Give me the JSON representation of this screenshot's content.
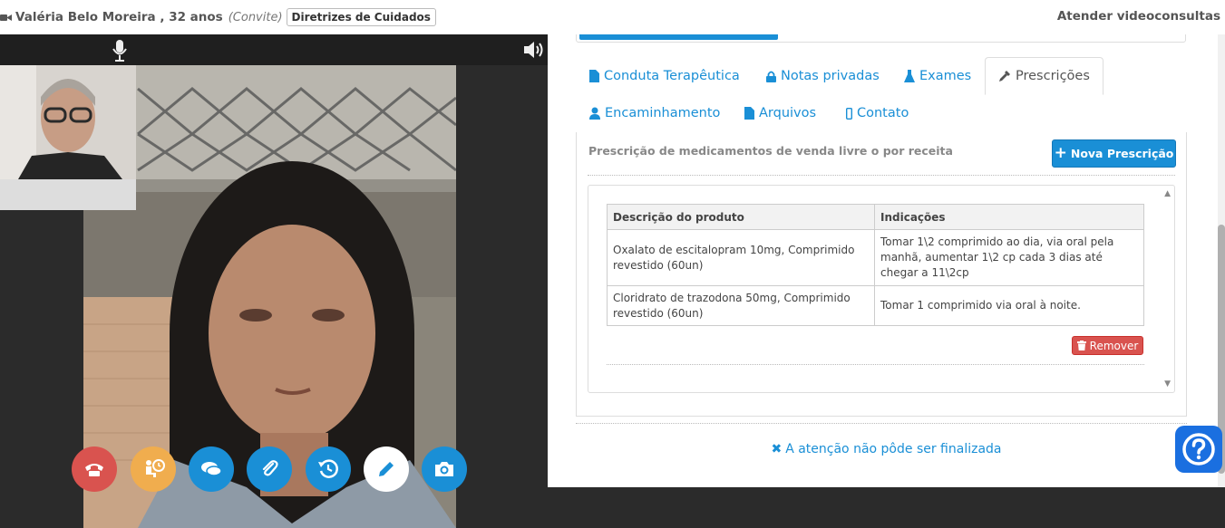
{
  "header": {
    "patient_name": "Valéria Belo Moreira , 32 anos",
    "convite": "(Convite)",
    "diretrizes_button": "Diretrizes de Cuidados",
    "attend_link": "Atender videoconsultas"
  },
  "tabs": [
    {
      "label": "Conduta Terapêutica",
      "icon": "file-icon"
    },
    {
      "label": "Notas privadas",
      "icon": "lock-icon"
    },
    {
      "label": "Exames",
      "icon": "flask-icon"
    },
    {
      "label": "Prescrições",
      "icon": "eyedropper-icon",
      "active": true
    },
    {
      "label": "Encaminhamento",
      "icon": "user-md-icon"
    },
    {
      "label": "Arquivos",
      "icon": "file-icon"
    },
    {
      "label": "Contato",
      "icon": "mobile-icon"
    }
  ],
  "prescription": {
    "title": "Prescrição de medicamentos de venda livre o por receita",
    "new_button": "Nova Prescrição",
    "columns": [
      "Descrição do produto",
      "Indicações"
    ],
    "rows": [
      {
        "product": "Oxalato de escitalopram 10mg, Comprimido revestido (60un)",
        "indication": "Tomar 1\\2 comprimido ao dia, via oral pela manhã, aumentar 1\\2 cp cada 3 dias até chegar a 11\\2cp"
      },
      {
        "product": "Cloridrato de trazodona 50mg, Comprimido revestido (60un)",
        "indication": "Tomar 1 comprimido via oral à noite."
      }
    ],
    "remove_button": "Remover"
  },
  "status": {
    "not_finalized": "A atenção não pôde ser finalizada"
  },
  "video_controls": [
    {
      "name": "hangup-button",
      "icon": "phone-icon",
      "color": "#d9534f"
    },
    {
      "name": "waiting-room-button",
      "icon": "waiting-clock-icon",
      "color": "#f0ad4e"
    },
    {
      "name": "chat-button",
      "icon": "chat-icon",
      "color": "#1a8fd6"
    },
    {
      "name": "attachment-button",
      "icon": "paperclip-icon",
      "color": "#1a8fd6"
    },
    {
      "name": "history-button",
      "icon": "history-icon",
      "color": "#1a8fd6"
    },
    {
      "name": "edit-button",
      "icon": "pencil-icon",
      "color": "#ffffff"
    },
    {
      "name": "snapshot-button",
      "icon": "camera-icon",
      "color": "#1a8fd6"
    }
  ],
  "colors": {
    "accent": "#1a8fd6",
    "danger": "#d9534f",
    "warning": "#f0ad4e"
  }
}
